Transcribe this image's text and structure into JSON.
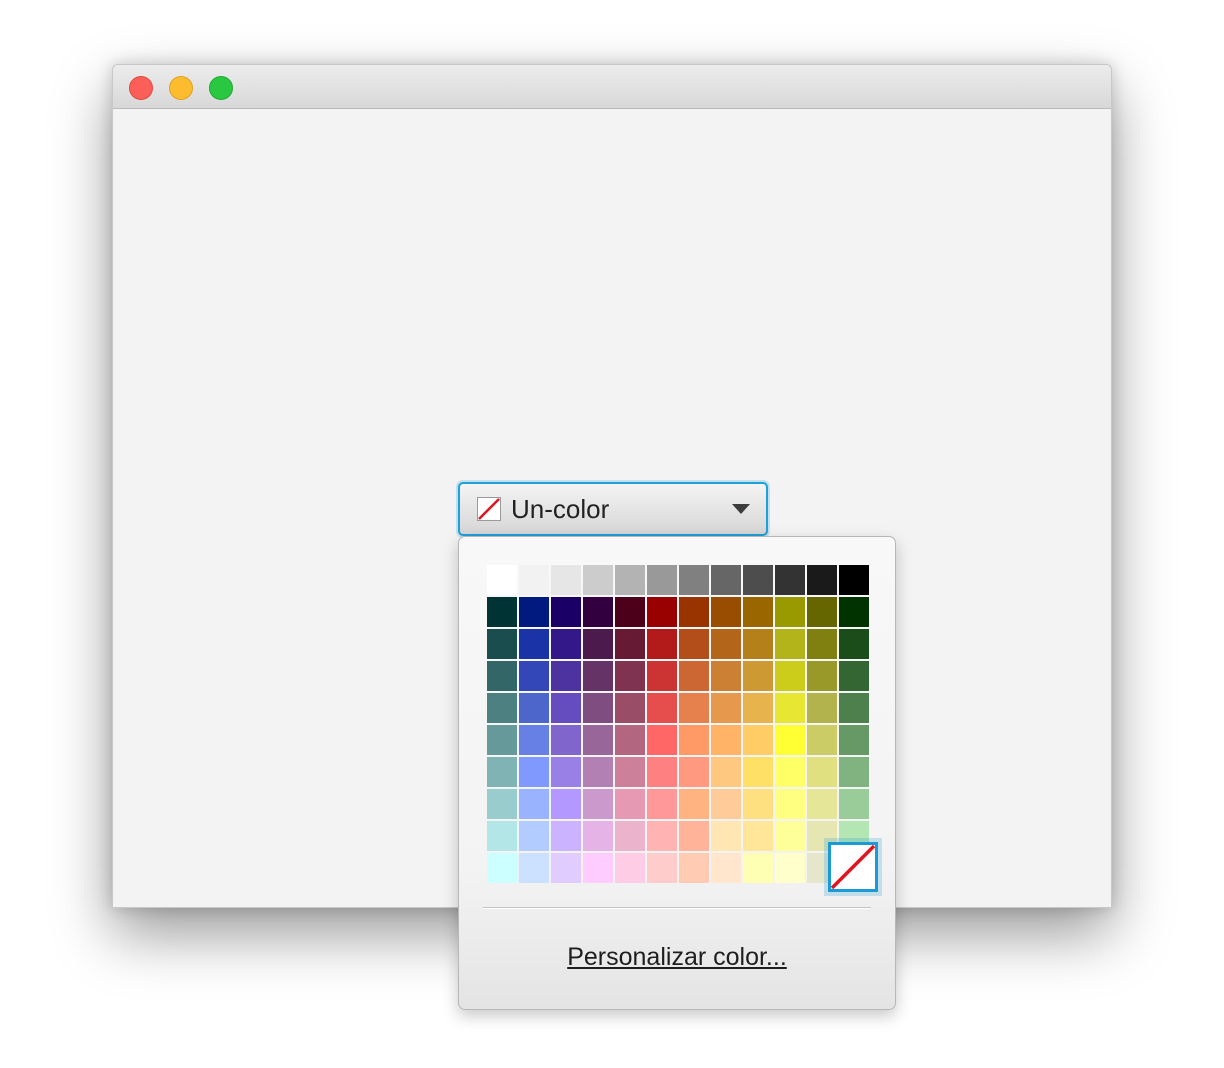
{
  "window": {
    "buttons": [
      "close",
      "minimize",
      "zoom"
    ]
  },
  "color_picker": {
    "selected_label": "Un-color",
    "selected_icon": "no-color-swatch-icon",
    "dropdown_icon": "chevron-down-icon",
    "accent_color": "#1ea0d8",
    "custom_color_link": "Personalizar color...",
    "palette": [
      [
        "#ffffff",
        "#f2f2f2",
        "#e6e6e6",
        "#cccccc",
        "#b3b3b3",
        "#999999",
        "#808080",
        "#666666",
        "#4d4d4d",
        "#333333",
        "#1a1a1a",
        "#000000"
      ],
      [
        "#003333",
        "#001a80",
        "#1a0066",
        "#33003f",
        "#4d0019",
        "#990000",
        "#993300",
        "#994d00",
        "#996600",
        "#999900",
        "#666600",
        "#003300"
      ],
      [
        "#1a4d4d",
        "#1a33a6",
        "#33188a",
        "#4d1a4d",
        "#661a33",
        "#b31a1a",
        "#b34d1a",
        "#b3661a",
        "#b3801a",
        "#b3b31a",
        "#808011",
        "#1a4d1a"
      ],
      [
        "#336666",
        "#3347b8",
        "#4d33a0",
        "#663366",
        "#803350",
        "#cc3333",
        "#cc6633",
        "#cc8033",
        "#cc9933",
        "#cccc1a",
        "#99992a",
        "#336633"
      ],
      [
        "#4d8080",
        "#4d66cc",
        "#664dbf",
        "#804d80",
        "#994d66",
        "#e64d4d",
        "#e6804d",
        "#e6994d",
        "#e6b34d",
        "#e6e633",
        "#b3b34d",
        "#4d804d"
      ],
      [
        "#669999",
        "#6680e6",
        "#8066cc",
        "#996699",
        "#b36680",
        "#ff6666",
        "#ff9966",
        "#ffb366",
        "#ffcc66",
        "#ffff33",
        "#cccc66",
        "#669966"
      ],
      [
        "#80b3b3",
        "#8099ff",
        "#9980e6",
        "#b380b3",
        "#cc8099",
        "#ff8080",
        "#ff9980",
        "#ffc880",
        "#ffe066",
        "#ffff66",
        "#e0e080",
        "#80b380"
      ],
      [
        "#99cccc",
        "#99b3ff",
        "#b399ff",
        "#cc99cc",
        "#e699b3",
        "#ff9999",
        "#ffb380",
        "#ffcc99",
        "#ffe080",
        "#ffff80",
        "#e6e699",
        "#99cc99"
      ],
      [
        "#b3e6e6",
        "#b3ccff",
        "#ccb3ff",
        "#e6b3e6",
        "#ebb3cc",
        "#ffb3b3",
        "#ffb399",
        "#ffe6b3",
        "#ffe699",
        "#ffff99",
        "#e6e6b3",
        "#b3e6b3"
      ],
      [
        "#ccffff",
        "#cce0ff",
        "#e0ccff",
        "#ffccff",
        "#ffcce6",
        "#ffcccc",
        "#ffccb3",
        "#ffe6cc",
        "#ffffb3",
        "#ffffcc",
        "#e6e6cc",
        "#ccffcc"
      ]
    ]
  }
}
